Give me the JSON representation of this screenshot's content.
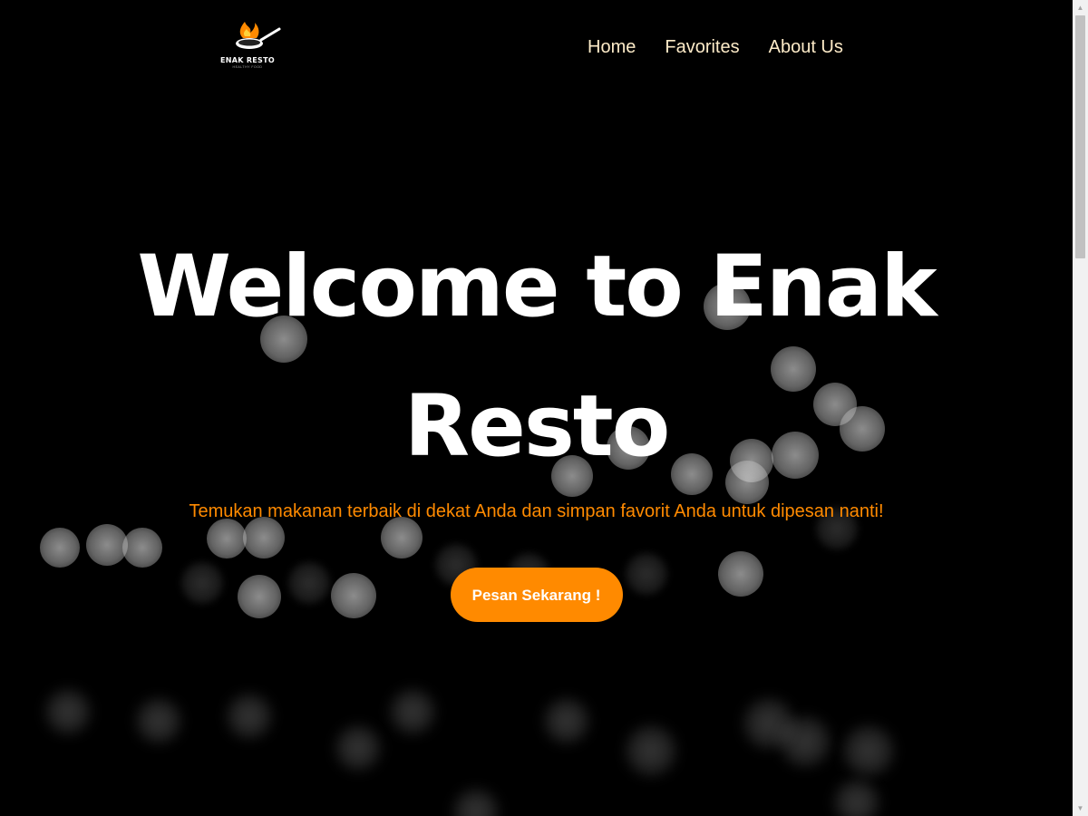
{
  "brand": {
    "name": "ENAK RESTO",
    "tagline": "HEALTHY FOOD",
    "logo_icon": "flaming-pan-icon"
  },
  "nav": {
    "items": [
      {
        "label": "Home"
      },
      {
        "label": "Favorites"
      },
      {
        "label": "About Us"
      }
    ]
  },
  "hero": {
    "title": "Welcome to Enak Resto",
    "subtitle": "Temukan makanan terbaik di dekat Anda dan simpan favorit Anda untuk dipesan nanti!",
    "cta_label": "Pesan Sekarang !"
  },
  "colors": {
    "accent": "#ff8a00",
    "nav_text": "#fdebc8",
    "background": "#000000",
    "title": "#ffffff"
  }
}
